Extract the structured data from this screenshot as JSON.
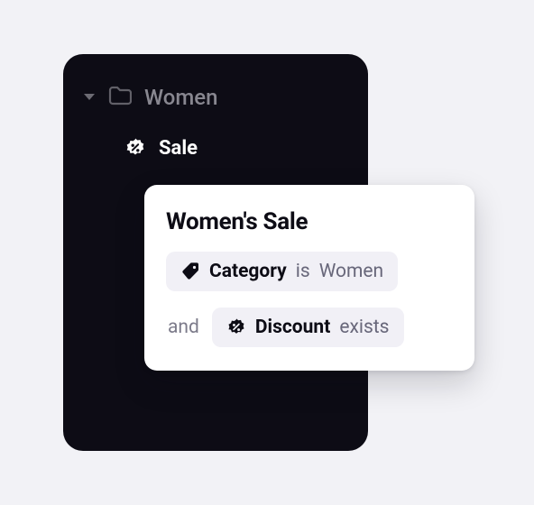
{
  "tree": {
    "top": {
      "label": "Women"
    },
    "sale": {
      "label": "Sale"
    }
  },
  "popup": {
    "title": "Women's Sale",
    "rule1": {
      "field": "Category",
      "op": "is",
      "value": "Women"
    },
    "conj": "and",
    "rule2": {
      "field": "Discount",
      "op": "exists"
    }
  }
}
